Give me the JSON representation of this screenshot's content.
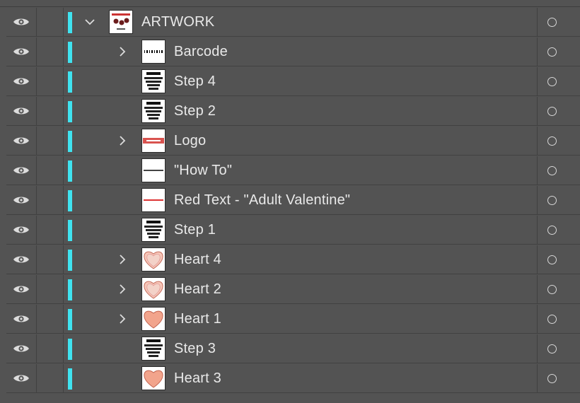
{
  "layers_panel": {
    "rows": [
      {
        "name": "ARTWORK",
        "level": 0,
        "expanded": true,
        "has_toggle": true,
        "thumb": "artwork"
      },
      {
        "name": "Barcode",
        "level": 1,
        "expanded": false,
        "has_toggle": true,
        "thumb": "barcode"
      },
      {
        "name": "Step 4",
        "level": 1,
        "expanded": false,
        "has_toggle": false,
        "thumb": "text"
      },
      {
        "name": "Step 2",
        "level": 1,
        "expanded": false,
        "has_toggle": false,
        "thumb": "text"
      },
      {
        "name": "Logo",
        "level": 1,
        "expanded": false,
        "has_toggle": true,
        "thumb": "logo"
      },
      {
        "name": "\"How To\"",
        "level": 1,
        "expanded": false,
        "has_toggle": false,
        "thumb": "line"
      },
      {
        "name": "Red Text - \"Adult Valentine\"",
        "level": 1,
        "expanded": false,
        "has_toggle": false,
        "thumb": "redline"
      },
      {
        "name": "Step 1",
        "level": 1,
        "expanded": false,
        "has_toggle": false,
        "thumb": "text"
      },
      {
        "name": "Heart 4",
        "level": 1,
        "expanded": false,
        "has_toggle": true,
        "thumb": "heart-light"
      },
      {
        "name": "Heart 2",
        "level": 1,
        "expanded": false,
        "has_toggle": true,
        "thumb": "heart-light"
      },
      {
        "name": "Heart 1",
        "level": 1,
        "expanded": false,
        "has_toggle": true,
        "thumb": "heart-dark"
      },
      {
        "name": "Step 3",
        "level": 1,
        "expanded": false,
        "has_toggle": false,
        "thumb": "text"
      },
      {
        "name": "Heart 3",
        "level": 1,
        "expanded": false,
        "has_toggle": false,
        "thumb": "heart-dark"
      }
    ]
  },
  "colors": {
    "panel_bg": "#535353",
    "layer_color": "#3fe3f0",
    "text": "#e9e9e9",
    "divider": "#414141"
  }
}
